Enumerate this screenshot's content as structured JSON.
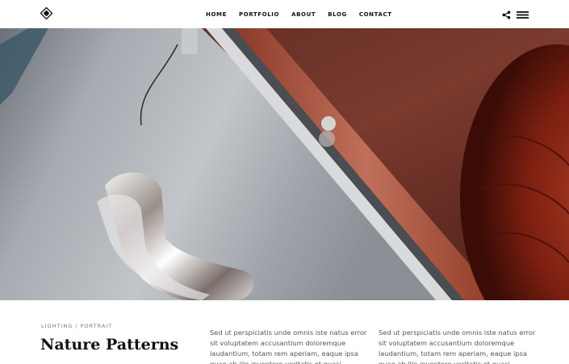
{
  "nav": {
    "items": [
      {
        "label": "HOME"
      },
      {
        "label": "PORTFOLIO"
      },
      {
        "label": "ABOUT"
      },
      {
        "label": "BLOG"
      },
      {
        "label": "CONTACT"
      }
    ]
  },
  "icons": {
    "logo": "diamond-logo-icon",
    "share": "share-icon",
    "menu": "hamburger-menu-icon"
  },
  "hero": {
    "image": "close-up of a silver vintage car door handle with red leather interior"
  },
  "project": {
    "category": "LIGHTING / PORTRAIT",
    "title": "Nature Patterns",
    "paragraph_1": "Sed ut perspiciatis unde omnis iste natus error sit voluptatem accusantium doloremque laudantium, totam rem aperiam, eaque ipsa quae ab illo inventore veritatis et quasi",
    "paragraph_2": "Sed ut perspiciatis unde omnis iste natus error sit voluptatem accusantium doloremque laudantium, totam rem aperiam, eaque ipsa quae ab illo inventore veritatis et quasi"
  },
  "colors": {
    "accent": "#111111",
    "leather": "#7a1f12",
    "car_body": "#a9adb3"
  }
}
